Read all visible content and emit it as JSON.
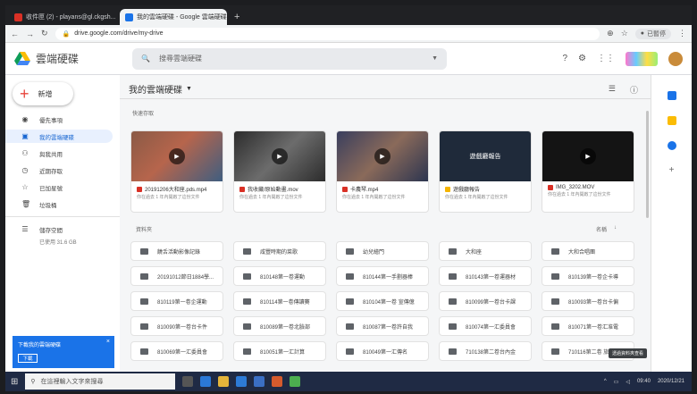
{
  "browser": {
    "tabs": [
      {
        "label": "收件匣 (2) - playans@gl.ckgsh...",
        "active": false
      },
      {
        "label": "我的雲端硬碟 - Google 雲端硬碟",
        "active": true
      }
    ],
    "new_tab": "+",
    "url": "drive.google.com/drive/my-drive",
    "paused_label": "已暫停"
  },
  "header": {
    "app_name": "雲端硬碟",
    "search_placeholder": "搜尋雲端硬碟"
  },
  "sidebar": {
    "new_label": "新增",
    "items": [
      {
        "label": "優先事項",
        "icon": "check-circle-icon"
      },
      {
        "label": "我的雲端硬碟",
        "icon": "drive-icon",
        "selected": true
      },
      {
        "label": "與我共用",
        "icon": "people-icon"
      },
      {
        "label": "近期存取",
        "icon": "clock-icon"
      },
      {
        "label": "已加星號",
        "icon": "star-icon"
      },
      {
        "label": "垃圾桶",
        "icon": "trash-icon"
      }
    ],
    "storage_label": "儲存空間",
    "storage_used": "已使用 31.6 GB"
  },
  "main": {
    "breadcrumb": "我的雲端硬碟",
    "quick_access_label": "快速存取",
    "quick_access": [
      {
        "name": "20191206大和座.pds.mp4",
        "sub": "你在過去 1 年內開啟了這份文件",
        "thumb": "#7a4a3c",
        "type_color": "#d93025",
        "video": true
      },
      {
        "name": "我收藏/原始動畫.mov",
        "sub": "你在過去 1 年內開啟了這份文件",
        "thumb": "#3a3a3a",
        "type_color": "#d93025",
        "video": true
      },
      {
        "name": "卡農琴.mp4",
        "sub": "你在過去 1 年內開啟了這份文件",
        "thumb": "#4a3f58",
        "type_color": "#d93025",
        "video": true
      },
      {
        "name": "遊戲廳報告",
        "sub": "你在過去 1 年內開啟了這份文件",
        "thumb": "#1f2a3a",
        "type_color": "#f4b400",
        "video": false,
        "thumb_text": "遊戲廳報告"
      },
      {
        "name": "IMG_3202.MOV",
        "sub": "你在過去 1 年內開啟了這份文件",
        "thumb": "#151515",
        "type_color": "#d93025",
        "video": true
      }
    ],
    "folders_label": "資料夾",
    "sort_label": "名稱",
    "folders": [
      "饒舌活動影像記錄",
      "咸豐時期的菜歌",
      "幼兒繪門",
      "大和座",
      "大和合唱團",
      "20191012節日1884學...",
      "810148第一卷運動",
      "810144第一手劃器棒",
      "810143第一卷運器材",
      "810139第一卷企卡導",
      "810119第一卷企運動",
      "810114第一卷傳讀賽",
      "810104第一卷 宣傳億",
      "810099第一卷台卡課",
      "810093第一卷台卡偏",
      "810090第一卷台卡件",
      "810089第一卷北臉部",
      "810087第一卷許自我",
      "810074第一汇委員會",
      "810071第一卷汇准電",
      "810069第一汇委員會",
      "810051第一汇計算",
      "810049第一汇傳名",
      "710138第二卷台內金",
      "710116第二卷 旅遊部"
    ],
    "scroll_badge": "透過資料夾查看"
  },
  "toast": {
    "title": "下載我的雲端硬碟",
    "button": "下載",
    "close": "×"
  },
  "taskbar": {
    "search_placeholder": "在這裡輸入文字來搜尋",
    "time": "09:40",
    "date": "2020/12/21"
  }
}
